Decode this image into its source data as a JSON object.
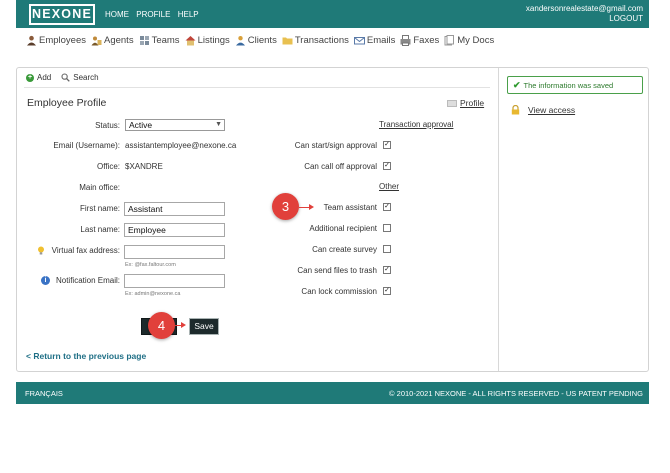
{
  "header": {
    "logo": "NEXONE",
    "nav": [
      "HOME",
      "PROFILE",
      "HELP"
    ],
    "user_email": "xandersonrealestate@gmail.com",
    "logout": "LOGOUT"
  },
  "mainnav": [
    {
      "label": "Employees",
      "icon": "employee-icon"
    },
    {
      "label": "Agents",
      "icon": "agent-icon"
    },
    {
      "label": "Teams",
      "icon": "teams-icon"
    },
    {
      "label": "Listings",
      "icon": "listings-icon"
    },
    {
      "label": "Clients",
      "icon": "clients-icon"
    },
    {
      "label": "Transactions",
      "icon": "folder-icon"
    },
    {
      "label": "Emails",
      "icon": "email-icon"
    },
    {
      "label": "Faxes",
      "icon": "fax-icon"
    },
    {
      "label": "My Docs",
      "icon": "docs-icon"
    }
  ],
  "toolbar": {
    "add": "Add",
    "search": "Search"
  },
  "profile": {
    "title": "Employee Profile",
    "profile_link": "Profile",
    "status_label": "Status:",
    "status_value": "Active",
    "email_label": "Email (Username):",
    "email_value": "assistantemployee@nexone.ca",
    "office_label": "Office:",
    "office_value": "$XANDRE",
    "main_office_label": "Main office:",
    "first_name_label": "First name:",
    "first_name_value": "Assistant",
    "last_name_label": "Last name:",
    "last_name_value": "Employee",
    "fax_label": "Virtual fax address:",
    "fax_hint": "Ex: @fax.faltour.com",
    "notification_label": "Notification Email:",
    "notification_hint": "Ex: admin@nexone.ca"
  },
  "permissions": {
    "transaction_heading": "Transaction approval",
    "other_heading": "Other",
    "items": [
      {
        "label": "Can start/sign approval",
        "checked": true
      },
      {
        "label": "Can call off approval",
        "checked": true
      },
      {
        "label": "Team assistant",
        "checked": true
      },
      {
        "label": "Additional recipient",
        "checked": false
      },
      {
        "label": "Can create survey",
        "checked": false
      },
      {
        "label": "Can send files to trash",
        "checked": true
      },
      {
        "label": "Can lock commission",
        "checked": true
      }
    ]
  },
  "buttons": {
    "save": "Save"
  },
  "back_link": "< Return to the previous page",
  "sidebar": {
    "success_message": "The information was saved",
    "view_access": "View access"
  },
  "footer": {
    "language": "FRANÇAIS",
    "copyright": "© 2010-2021 NEXONE - ALL RIGHTS RESERVED - US PATENT PENDING"
  },
  "callouts": {
    "step3": "3",
    "step4": "4"
  },
  "colors": {
    "brand": "#1f7a78",
    "callout": "#e1403b",
    "success": "#4aa04a",
    "link": "#1f6f86"
  }
}
